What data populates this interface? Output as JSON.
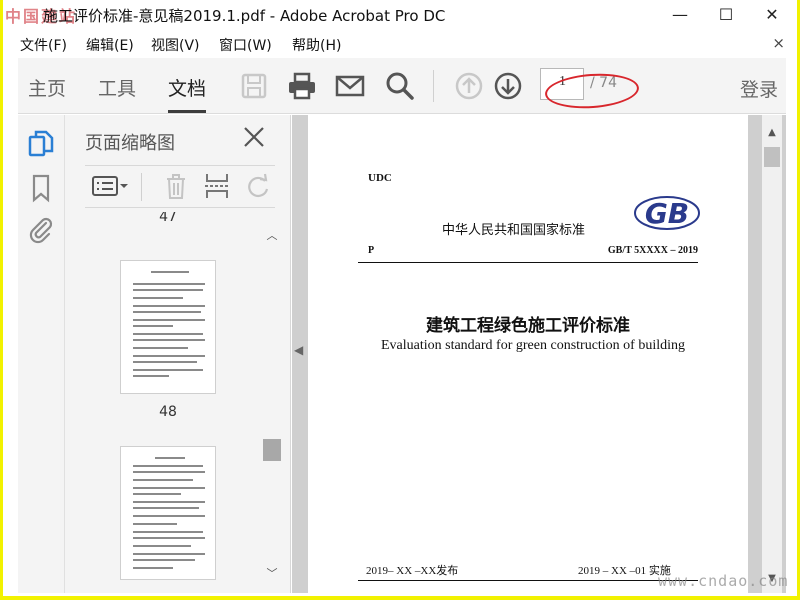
{
  "watermark_top": "中国建站",
  "watermark_bottom": "www.cndao.com",
  "window": {
    "title": "施工评价标准-意见稿2019.1.pdf - Adobe Acrobat Pro DC",
    "minimize": "—",
    "maximize": "☐",
    "close": "✕"
  },
  "menu": {
    "items": [
      "文件(F)",
      "编辑(E)",
      "视图(V)",
      "窗口(W)",
      "帮助(H)"
    ],
    "close": "×"
  },
  "toolbar": {
    "tabs": [
      "主页",
      "工具",
      "文档"
    ],
    "active_tab": "文档",
    "icons": [
      "save-icon",
      "print-icon",
      "email-icon",
      "search-icon",
      "page-up-icon",
      "page-down-icon"
    ],
    "page_current": "1",
    "page_total": "/ 74",
    "login": "登录",
    "highlight_color": "#d8262c"
  },
  "rail": {
    "icons": [
      "page-thumbnails-icon",
      "bookmark-icon",
      "attachment-icon"
    ],
    "active_color": "#2a7fd4"
  },
  "thumbnail_panel": {
    "title": "页面缩略图",
    "top_partial_number": "47",
    "pages": [
      {
        "number": "48"
      },
      {
        "number": ""
      }
    ],
    "tools": [
      "options-menu-icon",
      "delete-page-icon",
      "insert-page-icon",
      "rotate-icon"
    ]
  },
  "document": {
    "udc": "UDC",
    "country_label": "中华人民共和国国家标准",
    "logo_text": "GB",
    "p_mark": "P",
    "code": "GB/T 5XXXX – 2019",
    "title_zh": "建筑工程绿色施工评价标准",
    "title_en": "Evaluation standard for green construction of building",
    "issued": "2019– XX –XX发布",
    "effective": "2019 – XX –01  实施"
  }
}
